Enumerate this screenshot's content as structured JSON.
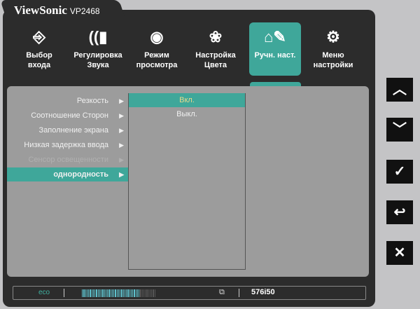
{
  "brand": {
    "name": "ViewSonic",
    "model": "VP2468"
  },
  "menu": [
    {
      "label1": "Выбор",
      "label2": "входа",
      "icon": "input-icon"
    },
    {
      "label1": "Регулировка",
      "label2": "Звука",
      "icon": "audio-icon"
    },
    {
      "label1": "Режим",
      "label2": "просмотра",
      "icon": "eye-icon"
    },
    {
      "label1": "Настройка",
      "label2": "Цвета",
      "icon": "color-icon"
    },
    {
      "label1": "Ручн. наст.",
      "label2": "",
      "icon": "manual-adjust-icon"
    },
    {
      "label1": "Меню",
      "label2": "настройки",
      "icon": "gear-icon"
    }
  ],
  "items": [
    "Резкость",
    "Соотношение Сторон",
    "Заполнение экрана",
    "Низкая задержка ввода",
    "Сенсор освещенности",
    "однородность"
  ],
  "options": [
    "Вкл.",
    "Выкл."
  ],
  "status": {
    "eco": "eco",
    "eco_level": 0.78,
    "resolution": "576i50"
  },
  "colors": {
    "accent": "#3fa79a",
    "panel": "#2c2c2c"
  }
}
